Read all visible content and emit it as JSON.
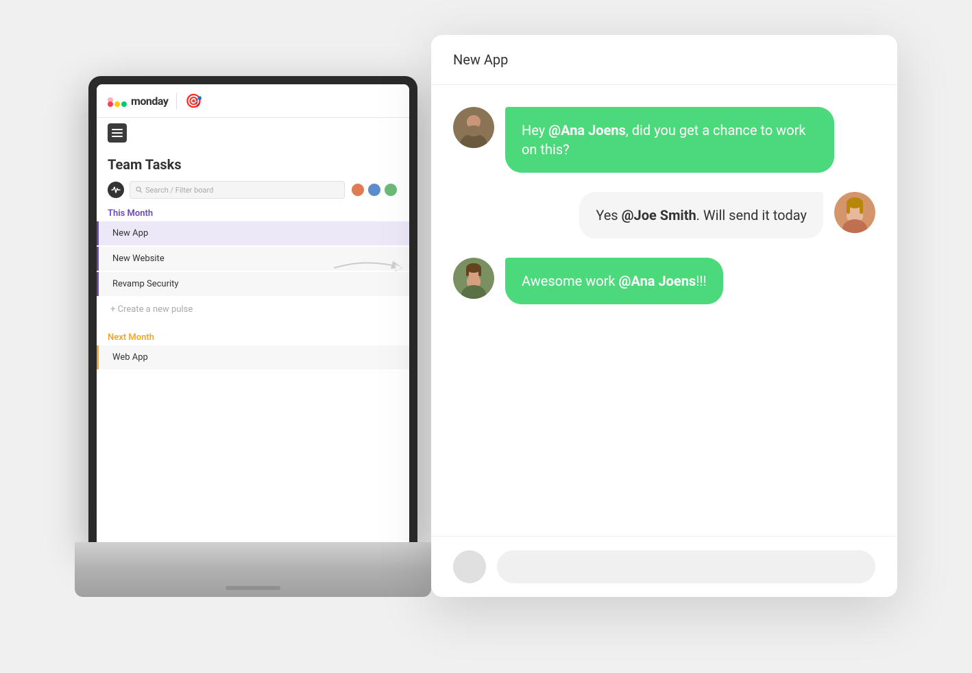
{
  "logo": {
    "text": "monday",
    "emoji": "🎯"
  },
  "board": {
    "title": "Team Tasks",
    "search_placeholder": "Search / Filter board"
  },
  "groups": [
    {
      "label": "This Month",
      "color": "purple",
      "items": [
        "New App",
        "New Website",
        "Revamp Security"
      ],
      "active_index": 0,
      "create_label": "+ Create a new pulse"
    },
    {
      "label": "Next Month",
      "color": "yellow",
      "items": [
        "Web App"
      ]
    }
  ],
  "chat": {
    "title": "New App",
    "messages": [
      {
        "id": 1,
        "side": "left",
        "text_parts": [
          "Hey ",
          "@Ana Joens",
          ", did you get a chance to work on this?"
        ],
        "mention_index": 1,
        "style": "green",
        "avatar_color": "#8b7355"
      },
      {
        "id": 2,
        "side": "right",
        "text_parts": [
          "Yes ",
          "@Joe Smith",
          ". Will send it today"
        ],
        "mention_index": 1,
        "style": "white",
        "avatar_color": "#c9967a"
      },
      {
        "id": 3,
        "side": "left",
        "text_parts": [
          "Awesome work ",
          "@Ana Joens",
          "!!!"
        ],
        "mention_index": 1,
        "style": "green",
        "avatar_color": "#5a8a6a"
      }
    ]
  },
  "colors": {
    "green_bubble": "#4cd97b",
    "purple_group": "#6b46c1",
    "yellow_group": "#f6a623"
  }
}
